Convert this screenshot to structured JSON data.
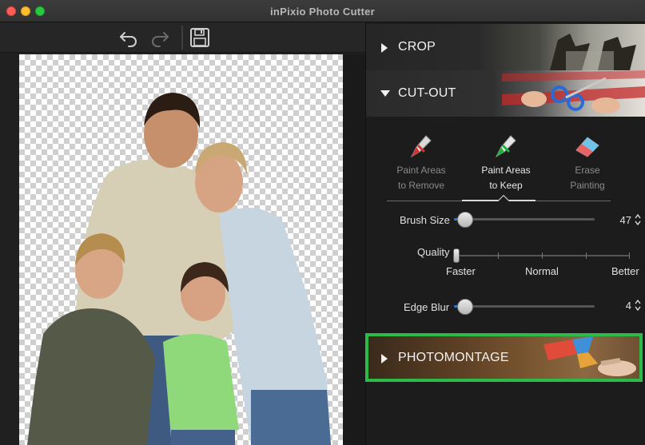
{
  "window": {
    "title": "inPixio Photo Cutter"
  },
  "toolbar": {
    "undo_icon": "undo-icon",
    "redo_icon": "redo-icon",
    "save_icon": "save-icon"
  },
  "panel": {
    "sections": {
      "crop": {
        "label": "CROP",
        "expanded": false
      },
      "cutout": {
        "label": "CUT-OUT",
        "expanded": true
      },
      "photomontage": {
        "label": "PHOTOMONTAGE",
        "expanded": false,
        "highlight_color": "#2dbb47"
      }
    },
    "tools": [
      {
        "line1": "Paint Areas",
        "line2": "to Remove",
        "icon": "red-marker-icon",
        "active": false
      },
      {
        "line1": "Paint Areas",
        "line2": "to Keep",
        "icon": "green-marker-icon",
        "active": true
      },
      {
        "line1": "Erase",
        "line2": "Painting",
        "icon": "eraser-icon",
        "active": false
      }
    ],
    "brush_size": {
      "label": "Brush Size",
      "value": "47",
      "fraction": 0.06
    },
    "quality": {
      "label": "Quality",
      "options": [
        "Faster",
        "Normal",
        "Better"
      ],
      "fraction": 0.0
    },
    "edge_blur": {
      "label": "Edge Blur",
      "value": "4",
      "fraction": 0.06
    }
  },
  "colors": {
    "accent": "#2d78e0",
    "highlight": "#2dbb47",
    "close": "#fe5f57",
    "minimize": "#febc2e",
    "maximize": "#28c840"
  }
}
